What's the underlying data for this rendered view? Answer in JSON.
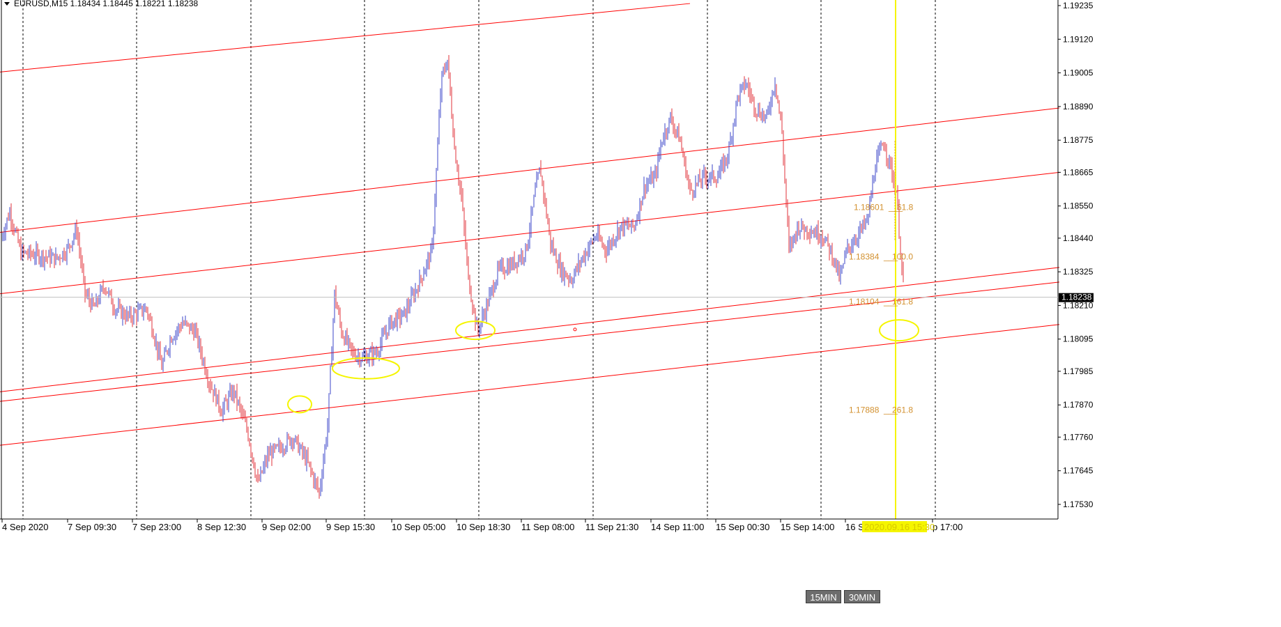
{
  "window": {
    "title": "EURUSD,M15  1.18434 1.18445 1.18221 1.18238"
  },
  "buttons": [
    {
      "label": "15MIN"
    },
    {
      "label": "30MIN"
    }
  ],
  "colors": {
    "bull": "#3b45c9",
    "bear": "#e0303a",
    "channel": "#ff0000",
    "marker": "#f5f500",
    "fib_text": "#d2902e",
    "price_label_bg": "#000000",
    "grid": "#000000"
  },
  "chart_data": {
    "type": "candlestick",
    "symbol": "EURUSD",
    "timeframe": "M15",
    "ohlc_current": {
      "open": 1.18434,
      "high": 1.18445,
      "low": 1.18221,
      "close": 1.18238
    },
    "current_price": 1.18238,
    "current_price_label": "1.18238",
    "ylim": [
      1.1747,
      1.1929
    ],
    "price_ticks": [
      "1.19235",
      "1.19120",
      "1.19005",
      "1.18890",
      "1.18775",
      "1.18665",
      "1.18550",
      "1.18440",
      "1.18325",
      "1.18210",
      "1.18095",
      "1.17985",
      "1.17870",
      "1.17760",
      "1.17645",
      "1.17530"
    ],
    "time_ticks": [
      "4 Sep 2020",
      "7 Sep 09:30",
      "7 Sep 23:00",
      "8 Sep 12:30",
      "9 Sep 02:00",
      "9 Sep 15:30",
      "10 Sep 05:00",
      "10 Sep 18:30",
      "11 Sep 08:00",
      "11 Sep 21:30",
      "14 Sep 11:00",
      "15 Sep 00:30",
      "15 Sep 14:00",
      "16 Se",
      "p 17:00"
    ],
    "cursor_time_label": "2020.09.16 15:30",
    "grid": "vertical dashed",
    "price_path": [
      [
        0,
        1.1843
      ],
      [
        14,
        1.1853
      ],
      [
        30,
        1.1839
      ],
      [
        60,
        1.1838
      ],
      [
        80,
        1.1837
      ],
      [
        96,
        1.184
      ],
      [
        110,
        1.1847
      ],
      [
        122,
        1.1825
      ],
      [
        135,
        1.182
      ],
      [
        150,
        1.1828
      ],
      [
        165,
        1.182
      ],
      [
        185,
        1.1817
      ],
      [
        210,
        1.182
      ],
      [
        220,
        1.1812
      ],
      [
        232,
        1.18
      ],
      [
        245,
        1.181
      ],
      [
        262,
        1.1815
      ],
      [
        280,
        1.1812
      ],
      [
        300,
        1.1795
      ],
      [
        318,
        1.1785
      ],
      [
        335,
        1.1792
      ],
      [
        355,
        1.1778
      ],
      [
        370,
        1.176
      ],
      [
        385,
        1.177
      ],
      [
        400,
        1.1772
      ],
      [
        420,
        1.1776
      ],
      [
        440,
        1.1768
      ],
      [
        458,
        1.1757
      ],
      [
        470,
        1.178
      ],
      [
        480,
        1.1825
      ],
      [
        490,
        1.1812
      ],
      [
        505,
        1.1805
      ],
      [
        520,
        1.1803
      ],
      [
        540,
        1.1805
      ],
      [
        560,
        1.1815
      ],
      [
        580,
        1.1818
      ],
      [
        600,
        1.1828
      ],
      [
        620,
        1.184
      ],
      [
        633,
        1.1898
      ],
      [
        642,
        1.1905
      ],
      [
        652,
        1.1875
      ],
      [
        662,
        1.1858
      ],
      [
        672,
        1.183
      ],
      [
        685,
        1.1812
      ],
      [
        700,
        1.1822
      ],
      [
        715,
        1.1833
      ],
      [
        735,
        1.1835
      ],
      [
        755,
        1.184
      ],
      [
        768,
        1.186
      ],
      [
        775,
        1.1868
      ],
      [
        790,
        1.1842
      ],
      [
        805,
        1.1833
      ],
      [
        820,
        1.183
      ],
      [
        835,
        1.1837
      ],
      [
        855,
        1.1845
      ],
      [
        870,
        1.184
      ],
      [
        890,
        1.1848
      ],
      [
        910,
        1.1848
      ],
      [
        925,
        1.1862
      ],
      [
        940,
        1.1865
      ],
      [
        950,
        1.1878
      ],
      [
        962,
        1.1885
      ],
      [
        975,
        1.1878
      ],
      [
        990,
        1.186
      ],
      [
        1010,
        1.1865
      ],
      [
        1030,
        1.1865
      ],
      [
        1045,
        1.1873
      ],
      [
        1058,
        1.1892
      ],
      [
        1070,
        1.1897
      ],
      [
        1085,
        1.1888
      ],
      [
        1100,
        1.1885
      ],
      [
        1112,
        1.1898
      ],
      [
        1122,
        1.188
      ],
      [
        1132,
        1.184
      ],
      [
        1145,
        1.1848
      ],
      [
        1160,
        1.1847
      ],
      [
        1180,
        1.1845
      ],
      [
        1195,
        1.1838
      ],
      [
        1205,
        1.183
      ],
      [
        1215,
        1.184
      ],
      [
        1230,
        1.1845
      ],
      [
        1245,
        1.185
      ],
      [
        1255,
        1.1868
      ],
      [
        1268,
        1.1877
      ],
      [
        1278,
        1.1868
      ],
      [
        1286,
        1.186
      ],
      [
        1294,
        1.1833
      ],
      [
        1298,
        1.18238
      ]
    ],
    "channel_lines": [
      {
        "x1": 0,
        "p1": 1.19008,
        "x2": 990,
        "p2": 1.19242
      },
      {
        "x1": 0,
        "p1": 1.1846,
        "x2": 1520,
        "p2": 1.18885
      },
      {
        "x1": 0,
        "p1": 1.1825,
        "x2": 1520,
        "p2": 1.18665
      },
      {
        "x1": 0,
        "p1": 1.17915,
        "x2": 1520,
        "p2": 1.1834
      },
      {
        "x1": 0,
        "p1": 1.17882,
        "x2": 1520,
        "p2": 1.1829
      },
      {
        "x1": 0,
        "p1": 1.17732,
        "x2": 1520,
        "p2": 1.18145
      }
    ],
    "fib_levels": [
      {
        "price_label": "1.18601",
        "level": "61.8",
        "x": 1225,
        "y_price": 1.18536
      },
      {
        "price_label": "1.18384",
        "level": "100.0",
        "x": 1218,
        "y_price": 1.18367
      },
      {
        "price_label": "1.18104",
        "level": "161.8",
        "x": 1218,
        "y_price": 1.18213
      },
      {
        "price_label": "1.17888",
        "level": "261.8",
        "x": 1218,
        "y_price": 1.17843
      }
    ],
    "annotations": [
      {
        "type": "ellipse",
        "cx": 525,
        "cy_price": 1.17995,
        "rx": 48,
        "ry": 15
      },
      {
        "type": "ellipse",
        "cx": 682,
        "cy_price": 1.18125,
        "rx": 28,
        "ry": 13
      },
      {
        "type": "ellipse",
        "cx": 430,
        "cy_price": 1.17872,
        "rx": 17,
        "ry": 12
      },
      {
        "type": "ellipse",
        "cx": 1290,
        "cy_price": 1.18125,
        "rx": 28,
        "ry": 15
      },
      {
        "type": "vline",
        "x": 1285
      }
    ]
  }
}
